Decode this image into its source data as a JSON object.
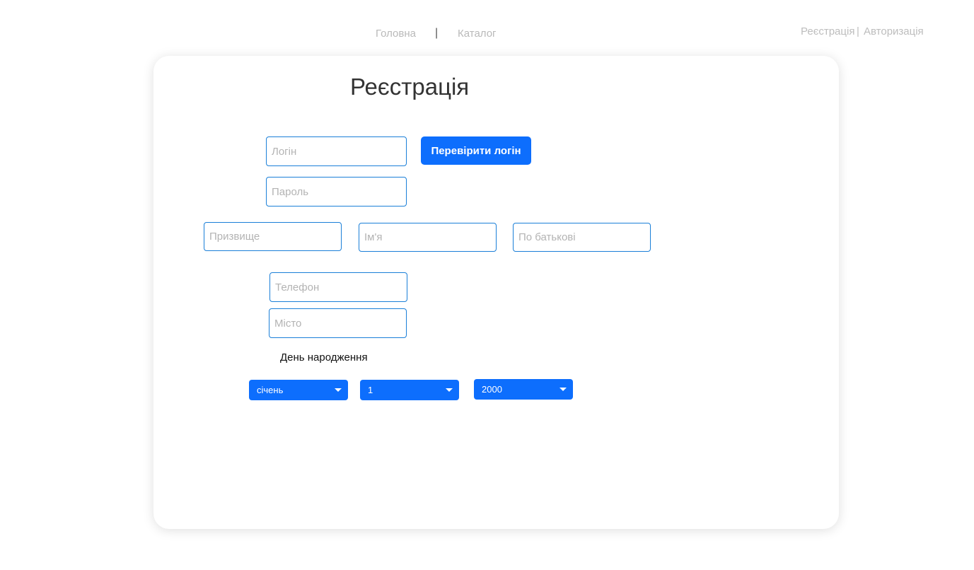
{
  "nav": {
    "home": "Головна",
    "separator": "|",
    "catalog": "Каталог"
  },
  "auth": {
    "register": "Реєстрація",
    "separator": "|",
    "login": "Авторизація"
  },
  "form": {
    "title": "Реєстрація",
    "login_placeholder": "Логін",
    "check_login_button": "Перевірити логін",
    "password_placeholder": "Пароль",
    "surname_placeholder": "Призвище",
    "name_placeholder": "Ім'я",
    "patronymic_placeholder": "По батькові",
    "phone_placeholder": "Телефон",
    "city_placeholder": "Місто",
    "birth_label": "День народження",
    "month_selected": "січень",
    "day_selected": "1",
    "year_selected": "2000"
  },
  "colors": {
    "accent": "#0d6efd",
    "field_border": "#1a7fd8"
  },
  "icons": {
    "dropdown": "caret-down-icon"
  }
}
